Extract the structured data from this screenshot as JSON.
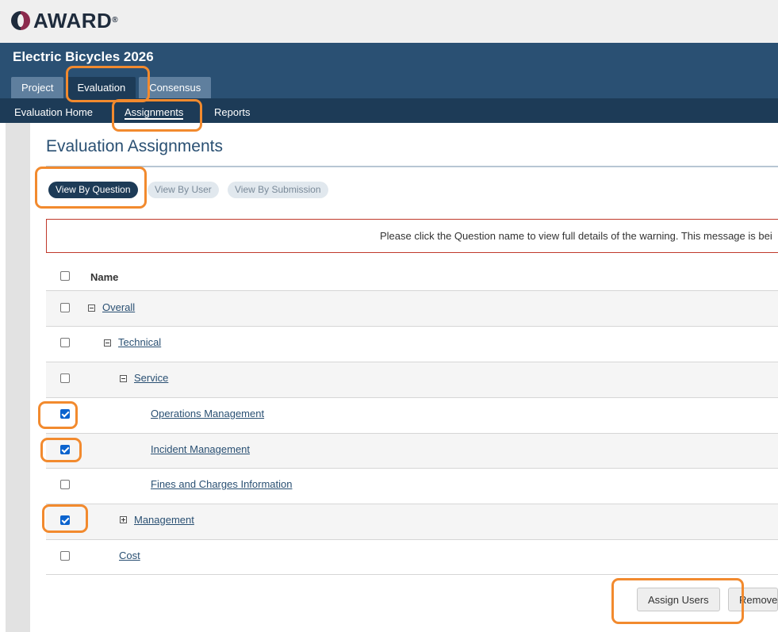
{
  "brand": {
    "logo_text": "AWARD",
    "logo_reg": "®"
  },
  "project": {
    "title": "Electric Bicycles 2026"
  },
  "tabs": [
    {
      "label": "Project",
      "active": false
    },
    {
      "label": "Evaluation",
      "active": true
    },
    {
      "label": "Consensus",
      "active": false
    }
  ],
  "subnav": [
    {
      "label": "Evaluation Home",
      "active": false
    },
    {
      "label": "Assignments",
      "active": true
    },
    {
      "label": "Reports",
      "active": false
    }
  ],
  "page": {
    "title": "Evaluation Assignments"
  },
  "view_toggle": [
    {
      "label": "View By Question",
      "active": true
    },
    {
      "label": "View By User",
      "active": false
    },
    {
      "label": "View By Submission",
      "active": false
    }
  ],
  "warning": {
    "text": "Please click the Question name to view full details of the warning. This message is bei"
  },
  "table": {
    "header": {
      "name": "Name",
      "checked": false
    },
    "rows": [
      {
        "label": "Overall",
        "toggle": "minus",
        "checked": false
      },
      {
        "label": "Technical",
        "toggle": "minus",
        "checked": false
      },
      {
        "label": "Service",
        "toggle": "minus",
        "checked": false
      },
      {
        "label": "Operations Management",
        "toggle": null,
        "checked": true
      },
      {
        "label": "Incident Management",
        "toggle": null,
        "checked": true
      },
      {
        "label": "Fines and Charges Information",
        "toggle": null,
        "checked": false
      },
      {
        "label": "Management",
        "toggle": "plus",
        "checked": true
      },
      {
        "label": "Cost",
        "toggle": null,
        "checked": false
      }
    ]
  },
  "actions": {
    "assign_users": "Assign Users",
    "remove": "Remove"
  },
  "colors": {
    "header_bg": "#2a5073",
    "subnav_bg": "#1d3b57",
    "highlight": "#f28a2e",
    "checkbox_checked": "#0b63ce"
  }
}
